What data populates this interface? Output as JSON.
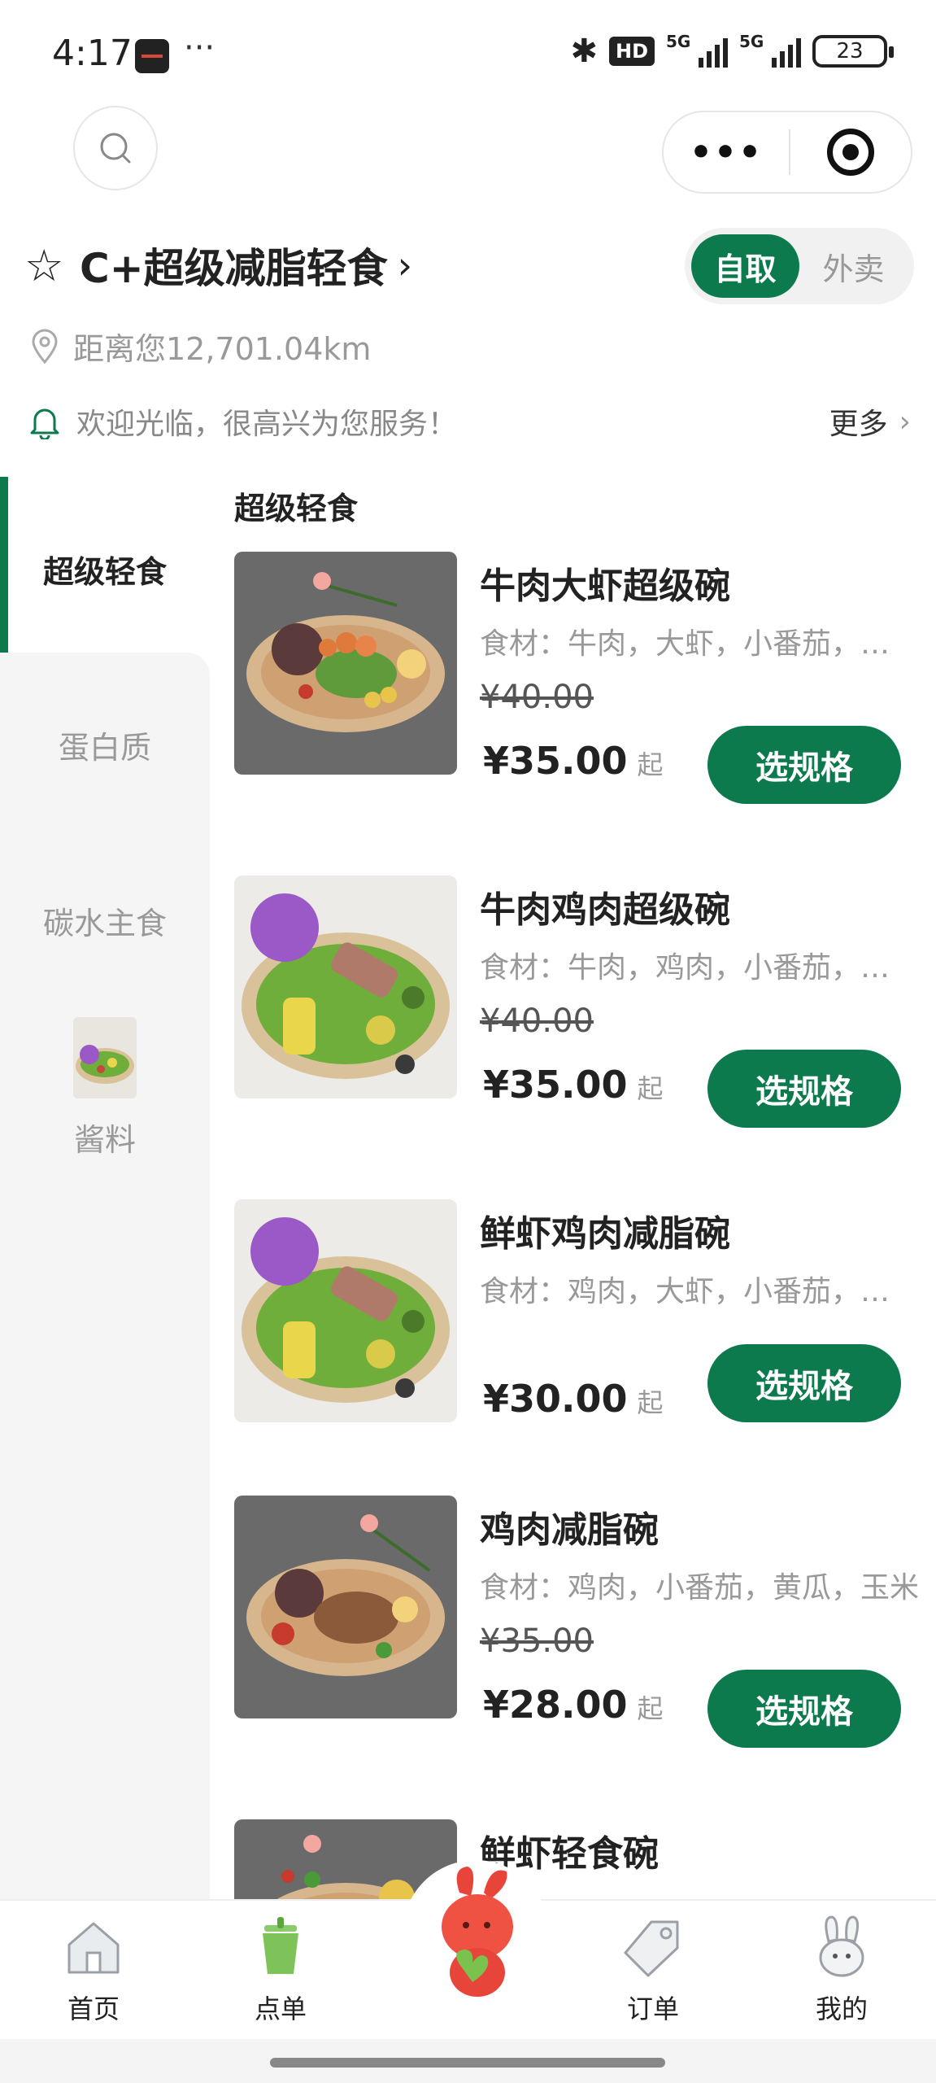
{
  "status_bar": {
    "time": "4:17",
    "dots": "···",
    "hd_label": "HD",
    "network_1": "5G",
    "network_2": "5G",
    "battery": "23"
  },
  "store": {
    "name": "C+超级减脂轻食",
    "distance": "距离您12,701.04km",
    "notice": "欢迎光临，很高兴为您服务！",
    "notice_more": "更多"
  },
  "mode_toggle": {
    "pickup": "自取",
    "delivery": "外卖"
  },
  "sidebar": {
    "items": [
      {
        "label": "超级轻食",
        "active": true
      },
      {
        "label": "蛋白质",
        "active": false
      },
      {
        "label": "碳水主食",
        "active": false
      },
      {
        "label": "酱料",
        "active": false
      }
    ]
  },
  "section_title": "超级轻食",
  "products": [
    {
      "name": "牛肉大虾超级碗",
      "ingredients": "食材：牛肉，大虾，小番茄，黄瓜，玉米",
      "original_price": "¥40.00",
      "price": "¥35.00",
      "price_suffix": "起",
      "button": "选规格"
    },
    {
      "name": "牛肉鸡肉超级碗",
      "ingredients": "食材：牛肉，鸡肉，小番茄，黄瓜，玉米",
      "original_price": "¥40.00",
      "price": "¥35.00",
      "price_suffix": "起",
      "button": "选规格"
    },
    {
      "name": "鲜虾鸡肉减脂碗",
      "ingredients": "食材：鸡肉，大虾，小番茄，黄瓜，玉米",
      "original_price": "",
      "price": "¥30.00",
      "price_suffix": "起",
      "button": "选规格"
    },
    {
      "name": "鸡肉减脂碗",
      "ingredients": "食材：鸡肉，小番茄，黄瓜，玉米",
      "original_price": "¥35.00",
      "price": "¥28.00",
      "price_suffix": "起",
      "button": "选规格"
    },
    {
      "name": "鲜虾轻食碗",
      "ingredients": "",
      "original_price": "",
      "price": "",
      "price_suffix": "",
      "button": ""
    }
  ],
  "bottom_nav": {
    "home": "首页",
    "order": "点单",
    "orders": "订单",
    "mine": "我的"
  },
  "colors": {
    "accent": "#0c7a4c",
    "sidebar_bg": "#f4f5f4",
    "muted_text": "#999999"
  }
}
